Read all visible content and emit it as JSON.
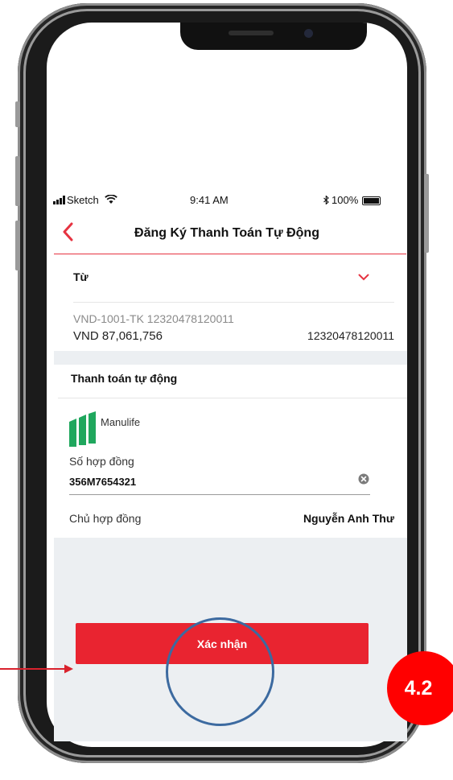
{
  "status_bar": {
    "carrier": "Sketch",
    "time": "9:41 AM",
    "battery": "100%"
  },
  "header": {
    "title": "Đăng Ký Thanh Toán Tự Động"
  },
  "from": {
    "label": "Từ",
    "account_name": "VND-1001-TK 12320478120011",
    "balance": "VND 87,061,756",
    "account_number": "12320478120011"
  },
  "auto_payment": {
    "section_title": "Thanh toán tự động",
    "provider": "Manulife",
    "contract_label": "Số hợp đồng",
    "contract_number": "356M7654321",
    "holder_label": "Chủ hợp đồng",
    "holder_name": "Nguyễn Anh Thư"
  },
  "confirm_button": {
    "label": "Xác nhận"
  },
  "annotation": {
    "step": "4.2"
  },
  "colors": {
    "accent": "#e92430",
    "circle": "#3c6aa0",
    "badge": "#ff0000",
    "background_grey": "#eceff2",
    "manulife_green": "#1fa75d"
  }
}
